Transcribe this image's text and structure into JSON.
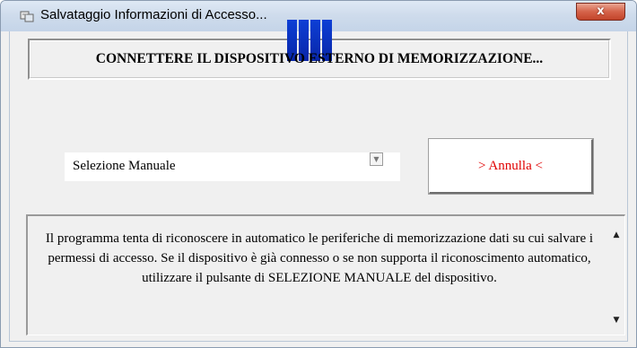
{
  "window": {
    "title": "Salvataggio Informazioni di Accesso...",
    "close_label": "x"
  },
  "banner": {
    "text": "CONNETTERE IL DISPOSITIVO ESTERNO DI MEMORIZZAZIONE...",
    "indicator_color": "#0a2fc0"
  },
  "selection": {
    "value": "Selezione Manuale",
    "dropdown_glyph": "▼"
  },
  "cancel_button": {
    "label": "> Annulla <",
    "label_color": "#e00000"
  },
  "info": {
    "text": "Il programma tenta di riconoscere in automatico le periferiche di memorizzazione dati su cui salvare i permessi di accesso. Se il dispositivo è già connesso o se non supporta il riconoscimento automatico, utilizzare il pulsante di SELEZIONE MANUALE del dispositivo.",
    "scroll_up_glyph": "▲",
    "scroll_down_glyph": "▼"
  }
}
